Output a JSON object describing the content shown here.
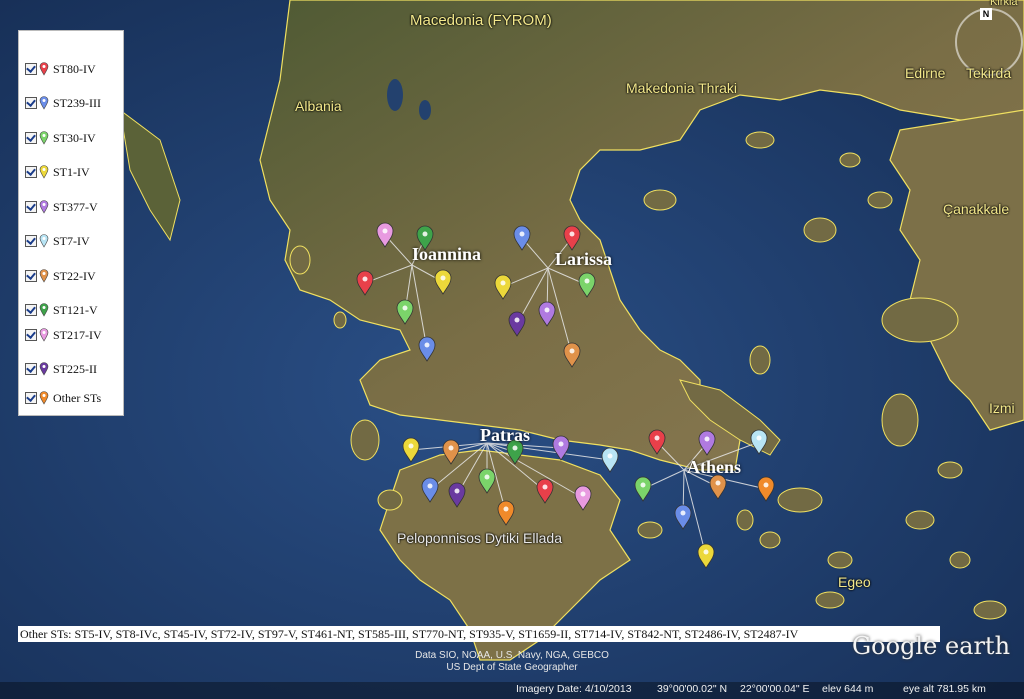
{
  "legend": {
    "items": [
      {
        "label": "ST80-IV",
        "color": "#e8404a"
      },
      {
        "label": "ST239-III",
        "color": "#6a8de8"
      },
      {
        "label": "ST30-IV",
        "color": "#7bd46a"
      },
      {
        "label": "ST1-IV",
        "color": "#ecd83a"
      },
      {
        "label": "ST377-V",
        "color": "#b07ae0"
      },
      {
        "label": "ST7-IV",
        "color": "#b8e4f4"
      },
      {
        "label": "ST22-IV",
        "color": "#e0924a"
      },
      {
        "label": "ST121-V",
        "color": "#3ea34a"
      },
      {
        "label": "ST217-IV",
        "color": "#e89ae0"
      },
      {
        "label": "ST225-II",
        "color": "#6a3aa0"
      },
      {
        "label": "Other STs",
        "color": "#f08a2a"
      }
    ]
  },
  "cities": [
    "Ioannina",
    "Larissa",
    "Patras",
    "Athens"
  ],
  "places": [
    "Macedonia (FYROM)",
    "Albania",
    "Makedonia Thraki",
    "Edirne",
    "Tekirda",
    "Çanakkale",
    "Izmi",
    "Egeo",
    "Peloponnisos Dytiki Ellada",
    "Kirkla"
  ],
  "other_sts": "Other STs: ST5-IV, ST8-IVc, ST45-IV, ST72-IV, ST97-V, ST461-NT, ST585-III, ST770-NT, ST935-V, ST1659-II, ST714-IV, ST842-NT, ST2486-IV, ST2487-IV",
  "credits": {
    "line1": "Data SIO, NOAA, U.S. Navy, NGA, GEBCO",
    "line2": "US Dept of State Geographer"
  },
  "status": {
    "imagery_date": "Imagery Date: 4/10/2013",
    "lat": "39°00'00.02\" N",
    "lon": "22°00'00.04\" E",
    "elev": "elev   644 m",
    "eye_alt": "eye alt 781.95 km"
  },
  "logo": "Google earth",
  "compass_n": "N",
  "colors": {
    "sea": "#1d3a66",
    "land": "#6b6a3e",
    "border": "#f0e060"
  }
}
